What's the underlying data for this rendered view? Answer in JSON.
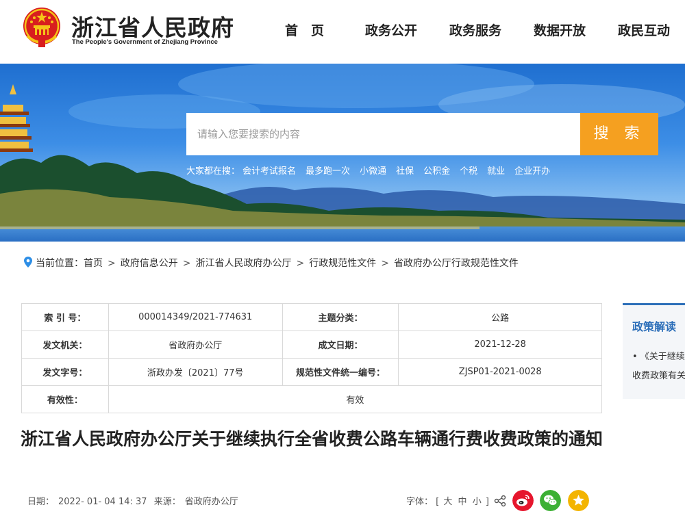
{
  "header": {
    "title": "浙江省人民政府",
    "subtitle": "The People's Government of Zhejiang Province",
    "nav": [
      "首　页",
      "政务公开",
      "政务服务",
      "数据开放",
      "政民互动"
    ]
  },
  "search": {
    "placeholder": "请输入您要搜索的内容",
    "button": "搜 索",
    "hot_label": "大家都在搜：",
    "hot_links": [
      "会计考试报名",
      "最多跑一次",
      "小微通",
      "社保",
      "公积金",
      "个税",
      "就业",
      "企业开办"
    ]
  },
  "breadcrumb": {
    "label": "当前位置：",
    "items": [
      "首页",
      "政府信息公开",
      "浙江省人民政府办公厅",
      "行政规范性文件",
      "省政府办公厅行政规范性文件"
    ]
  },
  "info": {
    "index_label": "索 引 号：",
    "index_value": "000014349/2021-774631",
    "topic_label": "主题分类：",
    "topic_value": "公路",
    "org_label": "发文机关：",
    "org_value": "省政府办公厅",
    "date_label": "成文日期：",
    "date_value": "2021-12-28",
    "docno_label": "发文字号：",
    "docno_value": "浙政办发〔2021〕77号",
    "code_label": "规范性文件统一编号：",
    "code_value": "ZJSP01-2021-0028",
    "valid_label": "有效性：",
    "valid_value": "有效"
  },
  "side": {
    "title": "政策解读",
    "item_line1": "•  《关于继续执行全省收费公路车辆通行费",
    "item_line2": "收费政策有关问题的解读"
  },
  "article": {
    "title": "浙江省人民政府办公厅关于继续执行全省收费公路车辆通行费收费政策的通知",
    "date_label": "日期：",
    "date": "2022- 01- 04 14: 37",
    "source_label": "来源：",
    "source": "省政府办公厅",
    "font_label": "字体：",
    "font_open": "[",
    "font_large": "大",
    "font_medium": "中",
    "font_small": "小",
    "font_close": "]"
  },
  "colors": {
    "accent_blue": "#2d6fb9",
    "search_orange": "#f5a020",
    "weibo_red": "#e6162d",
    "wechat_green": "#3cb034",
    "star_yellow": "#f3b400"
  },
  "icons": [
    "location-pin-icon",
    "share-icon",
    "weibo-icon",
    "wechat-icon",
    "star-icon"
  ]
}
